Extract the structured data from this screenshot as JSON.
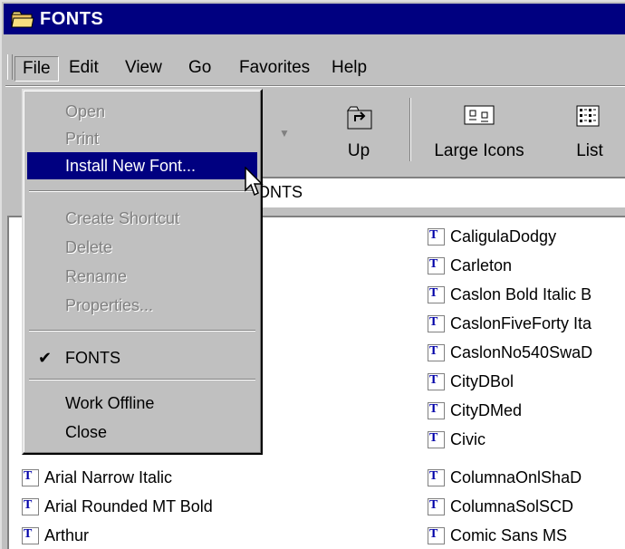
{
  "window": {
    "title": "FONTS"
  },
  "menubar": {
    "file": "File",
    "edit": "Edit",
    "view": "View",
    "go": "Go",
    "favorites": "Favorites",
    "help": "Help"
  },
  "toolbar": {
    "up": "Up",
    "large_icons": "Large Icons",
    "list": "List"
  },
  "address": {
    "value": "S\\FONTS"
  },
  "file_menu": {
    "open": "Open",
    "print": "Print",
    "install_new_font": "Install New Font...",
    "create_shortcut": "Create Shortcut",
    "delete": "Delete",
    "rename": "Rename",
    "properties": "Properties...",
    "fonts": "FONTS",
    "work_offline": "Work Offline",
    "close": "Close"
  },
  "files_left": [
    "Arial Narrow Italic",
    "Arial Rounded MT Bold",
    "Arthur"
  ],
  "files_right": [
    "CaligulaDodgy",
    "Carleton",
    "Caslon Bold Italic B",
    "CaslonFiveForty Ita",
    "CaslonNo540SwaD",
    "CityDBol",
    "CityDMed",
    "Civic",
    "ColumnaOnlShaD",
    "ColumnaSolSCD",
    "Comic Sans MS"
  ]
}
